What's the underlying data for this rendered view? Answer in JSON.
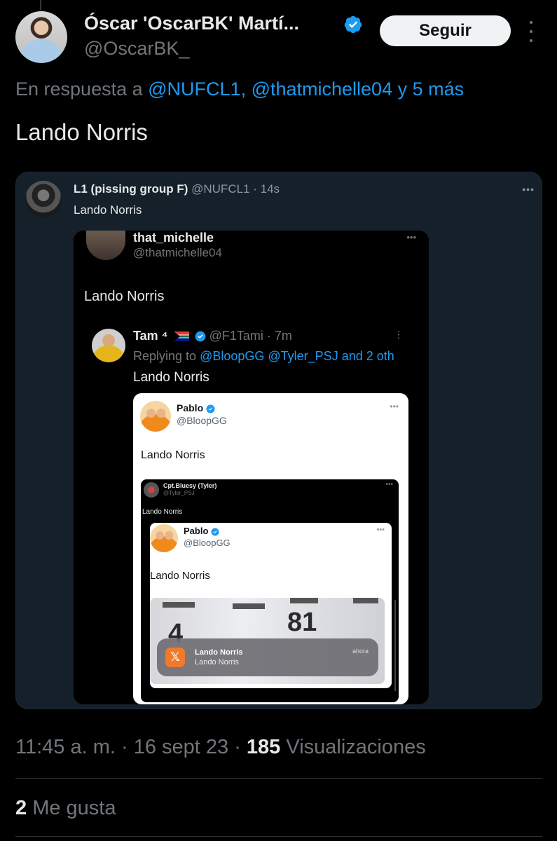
{
  "author": {
    "display_name": "Óscar 'OscarBK' Martí...",
    "handle": "@OscarBK_",
    "follow_label": "Seguir"
  },
  "reply": {
    "prefix": "En respuesta a",
    "mentions": "@NUFCL1, @thatmichelle04 y 5 más"
  },
  "tweet": {
    "text": "Lando Norris"
  },
  "embedded": {
    "l1": {
      "name": "L1 (pissing group F)",
      "meta": "@NUFCL1 · 14s",
      "text": "Lando Norris"
    },
    "michelle": {
      "name": "that_michelle",
      "handle": "@thatmichelle04",
      "text": "Lando Norris"
    },
    "tami": {
      "name": "Tam ⁴",
      "meta": "@F1Tami · 7m",
      "reply_prefix": "Replying to",
      "reply_mentions": "@BloopGG @Tyler_PSJ and 2 oth",
      "text": "Lando Norris"
    },
    "pablo": {
      "name": "Pablo",
      "handle": "@BloopGG",
      "text": "Lando Norris"
    },
    "cpt": {
      "name": "Cpt.Bluesy (Tyler)",
      "handle": "@Tyler_PSJ",
      "text": "Lando Norris"
    },
    "pablo2": {
      "name": "Pablo",
      "handle": "@BloopGG",
      "text": "Lando Norris"
    },
    "photo": {
      "num_left": "4",
      "num_right": "81"
    },
    "notification": {
      "title": "Lando Norris",
      "body": "Lando Norris",
      "time": "ahora",
      "icon_glyph": "𝕏"
    }
  },
  "stats": {
    "time": "11:45 a. m. · 16 sept 23 · ",
    "views_count": "185",
    "views_label": " Visualizaciones",
    "likes_count": "2",
    "likes_label": " Me gusta"
  },
  "colors": {
    "accent": "#1d9bf0",
    "background": "#000000",
    "muted": "#71767b",
    "card": "#15202b"
  },
  "icons": [
    "verified-icon",
    "more-icon",
    "x-logo-icon",
    "flag-icon"
  ]
}
